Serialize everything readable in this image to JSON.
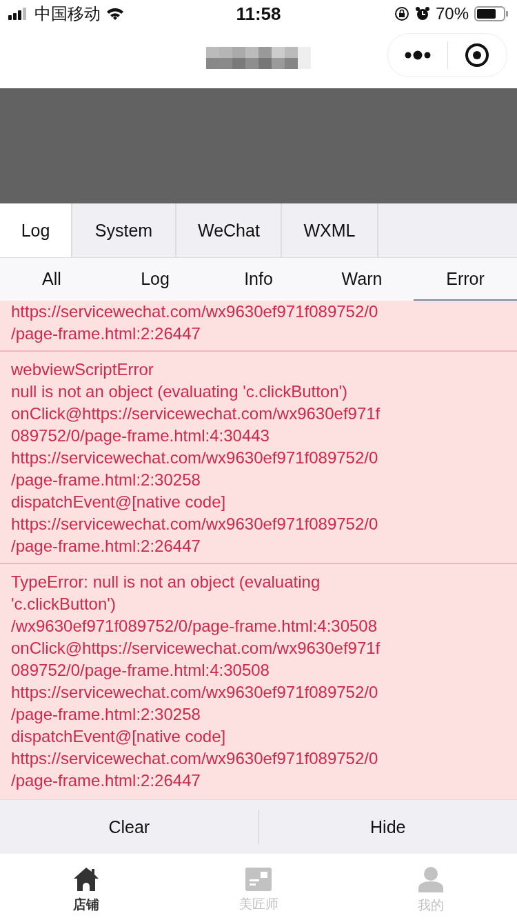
{
  "status_bar": {
    "carrier": "中国移动",
    "time": "11:58",
    "battery": "70%"
  },
  "debug_tabs": [
    {
      "label": "Log",
      "selected": true
    },
    {
      "label": "System",
      "selected": false
    },
    {
      "label": "WeChat",
      "selected": false
    },
    {
      "label": "WXML",
      "selected": false
    }
  ],
  "filters": [
    {
      "label": "All",
      "selected": false
    },
    {
      "label": "Log",
      "selected": false
    },
    {
      "label": "Info",
      "selected": false
    },
    {
      "label": "Warn",
      "selected": false
    },
    {
      "label": "Error",
      "selected": true
    }
  ],
  "log_entries": [
    {
      "lines": [
        "https://servicewechat.com/wx9630ef971f089752/0",
        "/page-frame.html:2:26447"
      ]
    },
    {
      "lines": [
        "webviewScriptError",
        "null is not an object (evaluating 'c.clickButton')",
        "onClick@https://servicewechat.com/wx9630ef971f",
        "089752/0/page-frame.html:4:30443",
        "https://servicewechat.com/wx9630ef971f089752/0",
        "/page-frame.html:2:30258",
        "dispatchEvent@[native code]",
        "https://servicewechat.com/wx9630ef971f089752/0",
        "/page-frame.html:2:26447"
      ]
    },
    {
      "lines": [
        "TypeError: null is not an object (evaluating",
        "'c.clickButton')",
        "/wx9630ef971f089752/0/page-frame.html:4:30508",
        "onClick@https://servicewechat.com/wx9630ef971f",
        "089752/0/page-frame.html:4:30508",
        "https://servicewechat.com/wx9630ef971f089752/0",
        "/page-frame.html:2:30258",
        "dispatchEvent@[native code]",
        "https://servicewechat.com/wx9630ef971f089752/0",
        "/page-frame.html:2:26447"
      ]
    }
  ],
  "actions": [
    "Clear",
    "Hide"
  ],
  "tab_bar": [
    {
      "label": "店铺",
      "kind": "home",
      "selected": true
    },
    {
      "label": "美匠师",
      "kind": "card",
      "selected": false
    },
    {
      "label": "我的",
      "kind": "person",
      "selected": false
    }
  ]
}
